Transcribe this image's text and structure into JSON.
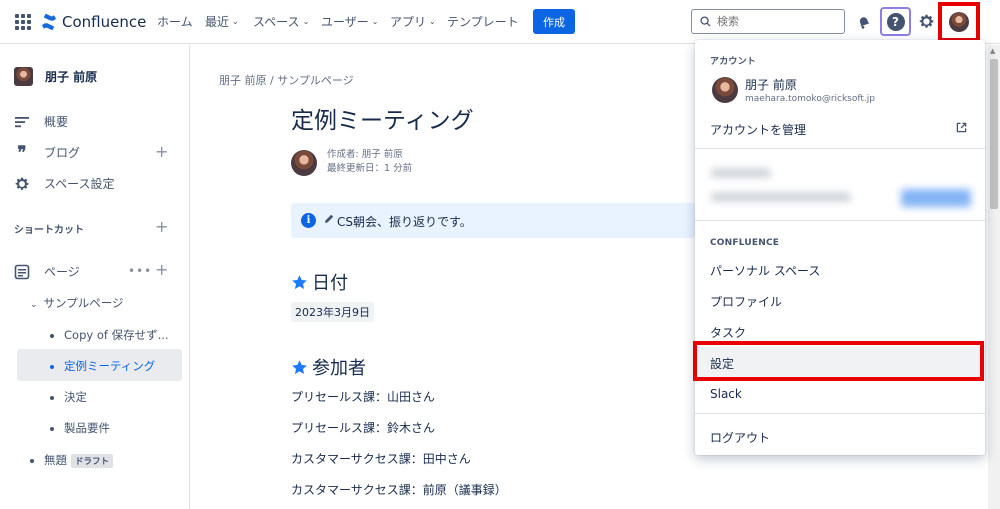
{
  "topnav": {
    "product": "Confluence",
    "items": [
      {
        "label": "ホーム",
        "dropdown": false
      },
      {
        "label": "最近",
        "dropdown": true
      },
      {
        "label": "スペース",
        "dropdown": true
      },
      {
        "label": "ユーザー",
        "dropdown": true
      },
      {
        "label": "アプリ",
        "dropdown": true
      },
      {
        "label": "テンプレート",
        "dropdown": false
      }
    ],
    "create_label": "作成",
    "search_placeholder": "検索",
    "help_glyph": "?"
  },
  "sidebar": {
    "space_name": "朋子 前原",
    "items": [
      {
        "label": "概要",
        "icon": "overview-icon"
      },
      {
        "label": "ブログ",
        "icon": "quote-icon"
      },
      {
        "label": "スペース設定",
        "icon": "gear-icon"
      }
    ],
    "shortcuts_title": "ショートカット",
    "pages_label": "ページ",
    "tree": [
      {
        "label": "サンプルページ",
        "level": 1
      },
      {
        "label": "Copy of 保存せず...",
        "level": 2
      },
      {
        "label": "定例ミーティング",
        "level": 2,
        "selected": true
      },
      {
        "label": "決定",
        "level": 2
      },
      {
        "label": "製品要件",
        "level": 2
      },
      {
        "label": "無題",
        "level": 1,
        "badge": "ドラフト"
      }
    ]
  },
  "page": {
    "breadcrumb": "朋子 前原  /  サンプルページ",
    "title": "定例ミーティング",
    "author_line": "作成者: 朋子 前原",
    "updated_line": "最終更新日：1 分前",
    "info_text": "CS朝会、振り返りです。",
    "info_glyph": "i",
    "section_date": "日付",
    "date_value": "2023年3月9日",
    "section_attendees": "参加者",
    "attendees": [
      "プリセールス課：山田さん",
      "プリセールス課：鈴木さん",
      "カスタマーサクセス課：田中さん",
      "カスタマーサクセス課：前原（議事録）"
    ]
  },
  "dropdown": {
    "account_title": "アカウント",
    "user_name": "朋子 前原",
    "user_email": "maehara.tomoko@ricksoft.jp",
    "manage_account": "アカウントを管理",
    "confluence_title": "CONFLUENCE",
    "items": [
      "パーソナル スペース",
      "プロファイル",
      "タスク",
      "設定",
      "Slack"
    ],
    "logout": "ログアウト"
  },
  "colors": {
    "accent": "#0c66e4",
    "highlight": "#e80000",
    "info_bg": "#e9f2ff",
    "help_outline": "#8f7ee7"
  }
}
